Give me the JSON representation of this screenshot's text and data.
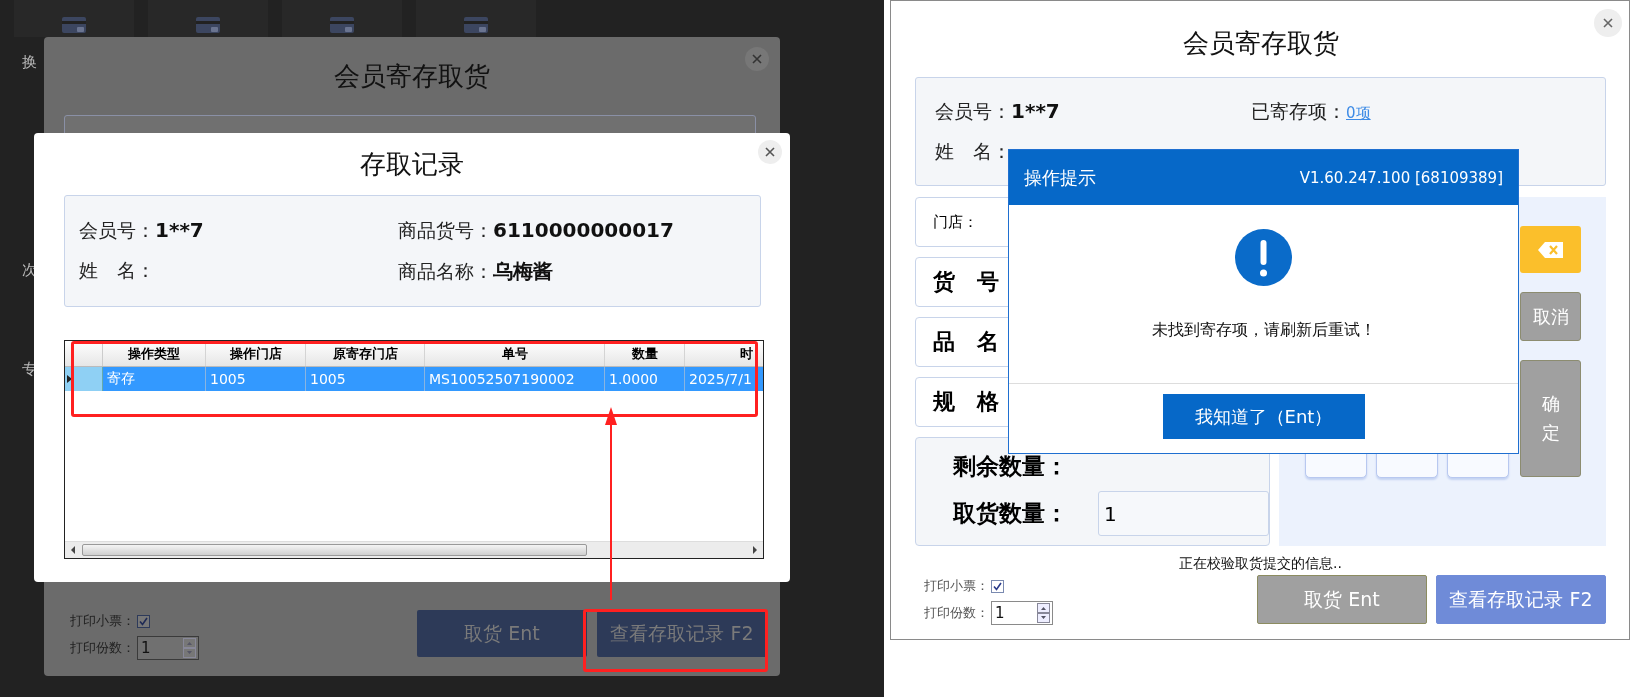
{
  "left_screen": {
    "side_labels": [
      "换",
      "次",
      "专"
    ],
    "main_dialog": {
      "title": "会员寄存取货",
      "print_receipt": {
        "label": "打印小票：",
        "checked": true
      },
      "copies": {
        "label": "打印份数：",
        "value": "1"
      },
      "buttons": [
        {
          "label": "取货 Ent"
        },
        {
          "label": "查看存取记录 F2"
        }
      ]
    },
    "records_dialog": {
      "title": "存取记录",
      "info": [
        {
          "label": "会员号：",
          "value": "1**7"
        },
        {
          "label": "商品货号：",
          "value": "6110000000017"
        },
        {
          "label": "姓　名："
        },
        {
          "label": "商品名称：",
          "value": "乌梅酱"
        }
      ],
      "table": {
        "columns": [
          "操作类型",
          "操作门店",
          "原寄存门店",
          "单号",
          "数量",
          "时"
        ],
        "rows": [
          {
            "selected": true,
            "cells": [
              "寄存",
              "1005",
              "1005",
              "MS10052507190002",
              "1.0000",
              "2025/7/1"
            ]
          }
        ]
      }
    },
    "annotations": [
      {
        "kind": "table-frame"
      },
      {
        "kind": "button-frame"
      },
      {
        "kind": "arrow"
      }
    ]
  },
  "right_screen": {
    "dialog": {
      "title": "会员寄存取货",
      "info": {
        "member": {
          "label": "会员号：",
          "value": "1**7"
        },
        "stored": {
          "label": "已寄存项：",
          "link": "0项"
        },
        "name": {
          "label": "姓　名："
        }
      },
      "fields": [
        {
          "kind": "small",
          "label": "门店："
        },
        {
          "kind": "large",
          "label": "货　号"
        },
        {
          "kind": "large",
          "label": "品　名"
        },
        {
          "kind": "large",
          "label": "规　格"
        }
      ],
      "quantities": {
        "remaining": {
          "label": "剩余数量："
        },
        "take": {
          "label": "取货数量：",
          "value": "1"
        }
      },
      "side_buttons": [
        {
          "kind": "backspace"
        },
        {
          "kind": "cancel",
          "label": "取消"
        },
        {
          "kind": "confirm",
          "label": "确定"
        }
      ],
      "status": "正在校验取货提交的信息..",
      "print_receipt": {
        "label": "打印小票：",
        "checked": true
      },
      "copies": {
        "label": "打印份数：",
        "value": "1"
      },
      "buttons": [
        {
          "label": "取货 Ent",
          "disabled": true
        },
        {
          "label": "查看存取记录 F2",
          "disabled": false
        }
      ]
    },
    "alert": {
      "title": "操作提示",
      "version": "V1.60.247.100 [68109389]",
      "message": "未找到寄存项，请刷新后重试！",
      "button": "我知道了（Ent）"
    }
  }
}
